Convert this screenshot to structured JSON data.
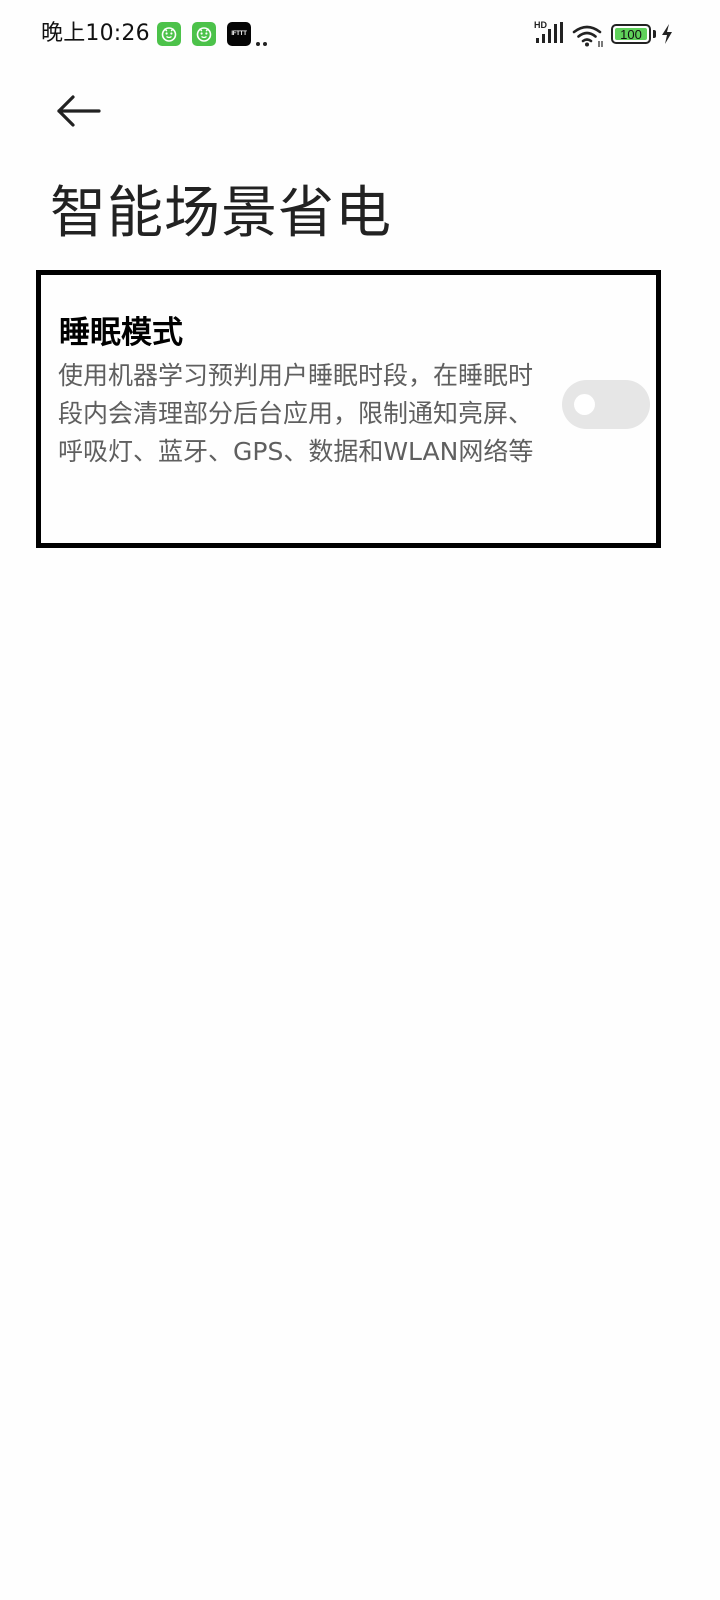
{
  "status_bar": {
    "time": "晚上10:26",
    "network_label": "HD",
    "battery_level": "100",
    "notification_icons": [
      "app-icon",
      "app-icon",
      "ifttt-icon",
      "more-notifications-icon"
    ],
    "ifttt_label": "IFTTT",
    "battery_color": "#5fd15a",
    "charging": true
  },
  "header": {
    "back_icon": "back-arrow-icon",
    "title": "智能场景省电"
  },
  "settings": {
    "sleep_mode": {
      "title": "睡眠模式",
      "description": "使用机器学习预判用户睡眠时段，在睡眠时段内会清理部分后台应用，限制通知亮屏、呼吸灯、蓝牙、GPS、数据和WLAN网络等",
      "enabled": false,
      "toggle_color": "#e6e6e6"
    }
  }
}
